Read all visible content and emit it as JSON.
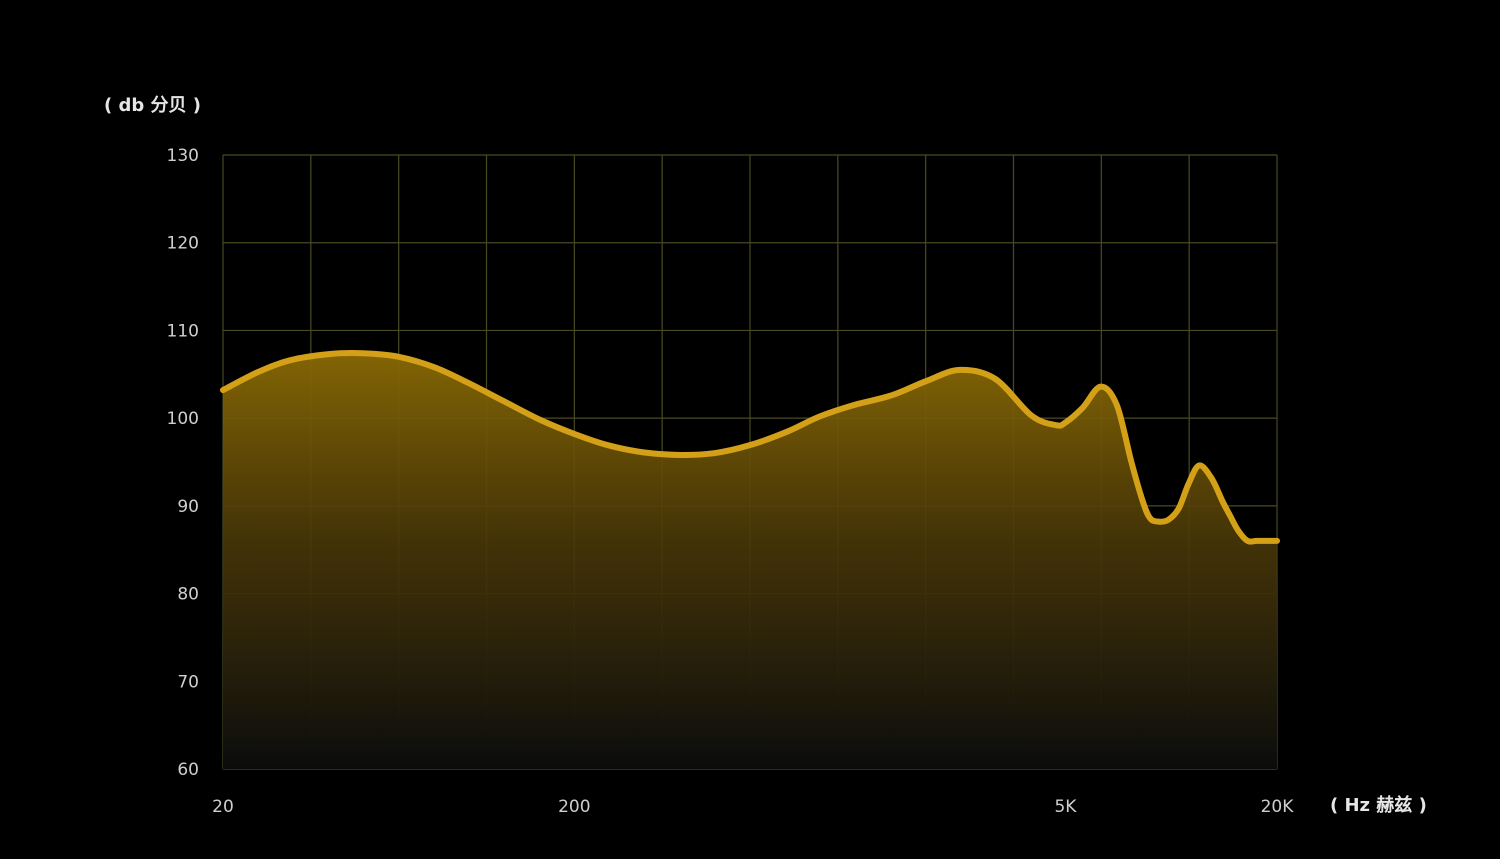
{
  "chart_data": {
    "type": "area",
    "ylabel": "( db 分贝 )",
    "xlabel": "( Hz 赫兹 )",
    "x_scale": "log",
    "xlim": [
      20,
      20000
    ],
    "ylim": [
      60,
      130
    ],
    "y_ticks": [
      {
        "value": 130,
        "label": "130"
      },
      {
        "value": 120,
        "label": "120"
      },
      {
        "value": 110,
        "label": "110"
      },
      {
        "value": 100,
        "label": "100"
      },
      {
        "value": 90,
        "label": "90"
      },
      {
        "value": 80,
        "label": "80"
      },
      {
        "value": 70,
        "label": "70"
      },
      {
        "value": 60,
        "label": "60"
      }
    ],
    "x_tick_labels": [
      {
        "value": 20,
        "label": "20"
      },
      {
        "value": 200,
        "label": "200"
      },
      {
        "value": 5000,
        "label": "5K"
      },
      {
        "value": 20000,
        "label": "20K"
      }
    ],
    "grid": true,
    "series": [
      {
        "color": "#d4a017",
        "x": [
          20,
          25,
          31,
          40,
          50,
          63,
          80,
          100,
          125,
          160,
          200,
          250,
          315,
          400,
          500,
          630,
          800,
          1000,
          1250,
          1600,
          2000,
          2500,
          3150,
          4000,
          4700,
          5000,
          5600,
          6300,
          7000,
          7700,
          8300,
          8700,
          9200,
          9800,
          10500,
          11200,
          12000,
          13000,
          14000,
          14700,
          15500,
          16500,
          17500,
          18800,
          20000
        ],
        "y": [
          103.2,
          105.2,
          106.6,
          107.3,
          107.4,
          107.0,
          105.8,
          104.0,
          102.0,
          99.8,
          98.2,
          96.9,
          96.1,
          95.8,
          96.0,
          96.9,
          98.4,
          100.2,
          101.5,
          102.6,
          104.2,
          105.5,
          104.5,
          100.3,
          99.2,
          99.5,
          101.2,
          103.6,
          101.5,
          95.0,
          90.5,
          88.6,
          88.2,
          88.4,
          89.7,
          92.5,
          94.6,
          93.2,
          90.5,
          88.9,
          87.2,
          86.0,
          86.0,
          86.0,
          86.0
        ]
      }
    ]
  }
}
